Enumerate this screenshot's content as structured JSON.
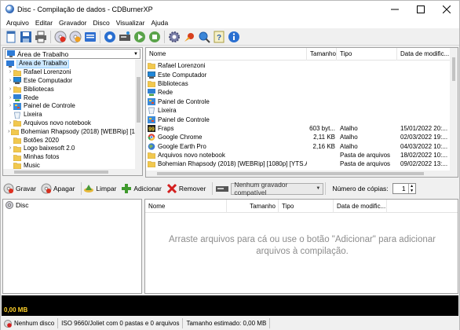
{
  "window": {
    "title": "Disc - Compilação de dados - CDBurnerXP"
  },
  "menu": [
    "Arquivo",
    "Editar",
    "Gravador",
    "Disco",
    "Visualizar",
    "Ajuda"
  ],
  "tree": {
    "combo_value": "Área de Trabalho",
    "items": [
      {
        "label": "Área de Trabalho",
        "level": 0,
        "icon": "desktop-icon",
        "chev": "",
        "selected": true
      },
      {
        "label": "Rafael Lorenzoni",
        "level": 1,
        "icon": "folder-icon",
        "chev": ">"
      },
      {
        "label": "Este Computador",
        "level": 1,
        "icon": "computer-icon",
        "chev": ">"
      },
      {
        "label": "Bibliotecas",
        "level": 1,
        "icon": "folder-icon",
        "chev": ">"
      },
      {
        "label": "Rede",
        "level": 1,
        "icon": "network-icon",
        "chev": ">"
      },
      {
        "label": "Painel de Controle",
        "level": 1,
        "icon": "control-panel-icon",
        "chev": ">"
      },
      {
        "label": "Lixeira",
        "level": 1,
        "icon": "recycle-bin-icon",
        "chev": ""
      },
      {
        "label": "Arquivos novo notebook",
        "level": 1,
        "icon": "folder-icon",
        "chev": ">"
      },
      {
        "label": "Bohemian Rhapsody (2018) [WEBRip] [1",
        "level": 1,
        "icon": "folder-icon",
        "chev": ">"
      },
      {
        "label": "Botões 2020",
        "level": 1,
        "icon": "folder-icon",
        "chev": ""
      },
      {
        "label": "Logo baixesoft 2.0",
        "level": 1,
        "icon": "folder-icon",
        "chev": ">"
      },
      {
        "label": "Minhas fotos",
        "level": 1,
        "icon": "folder-icon",
        "chev": ""
      },
      {
        "label": "Music",
        "level": 1,
        "icon": "folder-icon",
        "chev": ""
      }
    ]
  },
  "files": {
    "columns": [
      "Nome",
      "Tamanho",
      "Tipo",
      "Data de modific..."
    ],
    "rows": [
      {
        "name": "Rafael Lorenzoni",
        "size": "",
        "type": "",
        "date": "",
        "icon": "folder-icon"
      },
      {
        "name": "Este Computador",
        "size": "",
        "type": "",
        "date": "",
        "icon": "computer-icon"
      },
      {
        "name": "Bibliotecas",
        "size": "",
        "type": "",
        "date": "",
        "icon": "folder-icon"
      },
      {
        "name": "Rede",
        "size": "",
        "type": "",
        "date": "",
        "icon": "network-icon"
      },
      {
        "name": "Painel de Controle",
        "size": "",
        "type": "",
        "date": "",
        "icon": "control-panel-icon"
      },
      {
        "name": "Lixeira",
        "size": "",
        "type": "",
        "date": "",
        "icon": "recycle-bin-icon"
      },
      {
        "name": "Painel de Controle",
        "size": "",
        "type": "",
        "date": "",
        "icon": "control-panel-icon"
      },
      {
        "name": "Fraps",
        "size": "603 byt...",
        "type": "Atalho",
        "date": "15/01/2022 20:...",
        "icon": "fraps-icon"
      },
      {
        "name": "Google Chrome",
        "size": "2,11 KB",
        "type": "Atalho",
        "date": "02/03/2022 19:...",
        "icon": "chrome-icon"
      },
      {
        "name": "Google Earth Pro",
        "size": "2,16 KB",
        "type": "Atalho",
        "date": "04/03/2022 10:...",
        "icon": "earth-icon"
      },
      {
        "name": "Arquivos novo notebook",
        "size": "",
        "type": "Pasta de arquivos",
        "date": "18/02/2022 10:...",
        "icon": "folder-icon"
      },
      {
        "name": "Bohemian Rhapsody (2018) [WEBRip] [1080p] [YTS.A...",
        "size": "",
        "type": "Pasta de arquivos",
        "date": "09/02/2022 13:...",
        "icon": "folder-icon"
      },
      {
        "name": "Botões 2020",
        "size": "",
        "type": "Pasta de arquivos",
        "date": "18/10/2021 17:...",
        "icon": "folder-icon"
      }
    ]
  },
  "actions": {
    "gravar": "Gravar",
    "apagar": "Apagar",
    "limpar": "Limpar",
    "adicionar": "Adicionar",
    "remover": "Remover",
    "recorder_value": "Nenhum gravador compatível",
    "copies_label": "Número de cópias:",
    "copies_value": "1"
  },
  "disc": {
    "root_label": "Disc"
  },
  "compilation": {
    "columns": [
      "Nome",
      "Tamanho",
      "Tipo",
      "Data de modific..."
    ],
    "empty_line1": "Arraste arquivos para cá ou use o botão \"Adicionar\" para adicionar",
    "empty_line2": "arquivos à compilação."
  },
  "capacity": {
    "label": "0,00 MB",
    "used_fraction": 0
  },
  "status": {
    "disc": "Nenhum disco",
    "fs": "ISO 9660/Joliet com 0 pastas e 0 arquivos",
    "size": "Tamanho estimado: 0,00 MB"
  },
  "colors": {
    "accent": "#0078d7",
    "selection": "#cce8ff",
    "capacity_bg": "#000000",
    "capacity_text": "#ffd22a"
  }
}
